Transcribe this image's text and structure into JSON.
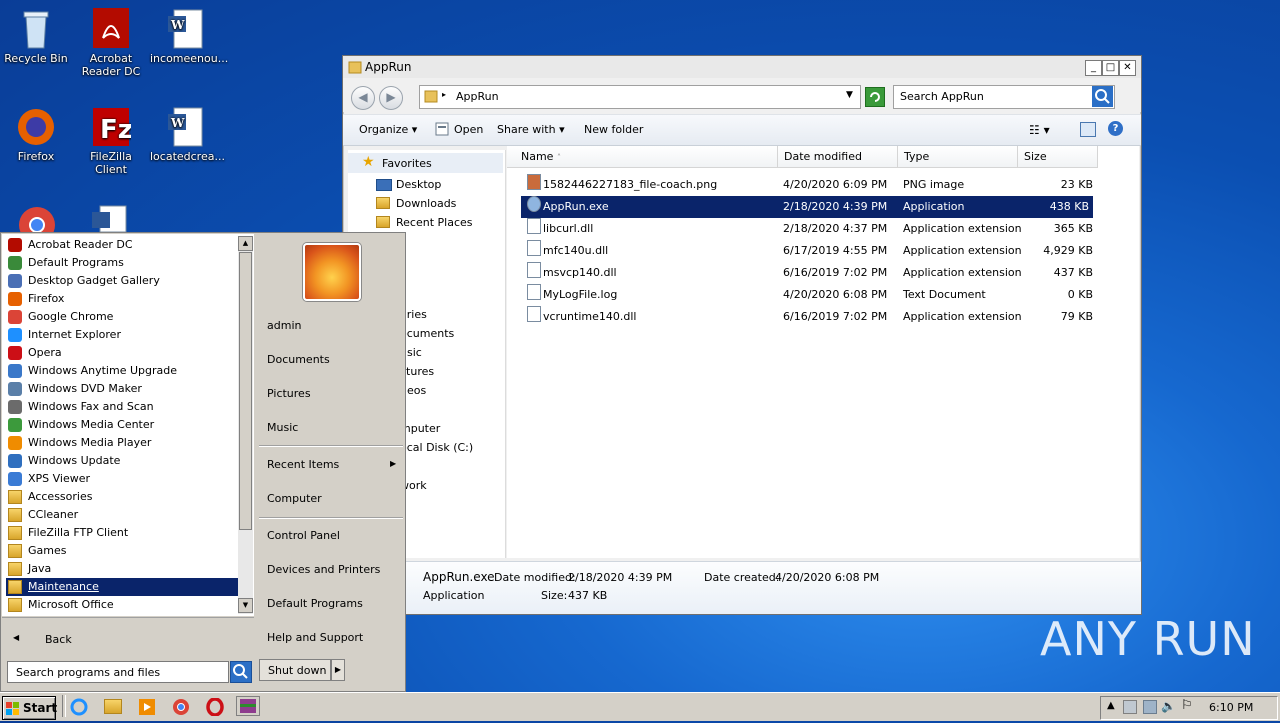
{
  "desktop": {
    "icons": [
      {
        "label": "Recycle Bin"
      },
      {
        "label": "Acrobat\nReader DC"
      },
      {
        "label": "incomeenou..."
      },
      {
        "label": "Firefox"
      },
      {
        "label": "FileZilla Client"
      },
      {
        "label": "locatedcrea..."
      }
    ]
  },
  "explorer": {
    "title": "AppRun",
    "address": "AppRun",
    "search_placeholder": "Search AppRun",
    "toolbar": {
      "organize": "Organize",
      "open": "Open",
      "share_with": "Share with",
      "new_folder": "New folder"
    },
    "nav": {
      "favorites": "Favorites",
      "items": [
        "Desktop",
        "Downloads",
        "Recent Places"
      ],
      "partial": [
        "aries",
        "ocuments",
        "usic",
        "ctures",
        "deos",
        "mputer",
        "ocal Disk (C:)",
        "work"
      ]
    },
    "columns": [
      "Name",
      "Date modified",
      "Type",
      "Size"
    ],
    "files": [
      {
        "name": "1582446227183_file-coach.png",
        "date": "4/20/2020 6:09 PM",
        "type": "PNG image",
        "size": "23 KB",
        "selected": false
      },
      {
        "name": "AppRun.exe",
        "date": "2/18/2020 4:39 PM",
        "type": "Application",
        "size": "438 KB",
        "selected": true
      },
      {
        "name": "libcurl.dll",
        "date": "2/18/2020 4:37 PM",
        "type": "Application extension",
        "size": "365 KB",
        "selected": false
      },
      {
        "name": "mfc140u.dll",
        "date": "6/17/2019 4:55 PM",
        "type": "Application extension",
        "size": "4,929 KB",
        "selected": false
      },
      {
        "name": "msvcp140.dll",
        "date": "6/16/2019 7:02 PM",
        "type": "Application extension",
        "size": "437 KB",
        "selected": false
      },
      {
        "name": "MyLogFile.log",
        "date": "4/20/2020 6:08 PM",
        "type": "Text Document",
        "size": "0 KB",
        "selected": false
      },
      {
        "name": "vcruntime140.dll",
        "date": "6/16/2019 7:02 PM",
        "type": "Application extension",
        "size": "79 KB",
        "selected": false
      }
    ],
    "details": {
      "name": "AppRun.exe",
      "modified_label": "Date modified:",
      "modified": "2/18/2020 4:39 PM",
      "created_label": "Date created:",
      "created": "4/20/2020 6:08 PM",
      "type": "Application",
      "size_label": "Size:",
      "size": "437 KB"
    }
  },
  "startmenu": {
    "programs": [
      {
        "label": "Acrobat Reader DC",
        "color": "#b30b00"
      },
      {
        "label": "Default Programs",
        "color": "#3a8a3a"
      },
      {
        "label": "Desktop Gadget Gallery",
        "color": "#4a6fb5"
      },
      {
        "label": "Firefox",
        "color": "#e66000"
      },
      {
        "label": "Google Chrome",
        "color": "#db4437"
      },
      {
        "label": "Internet Explorer",
        "color": "#1e90ff"
      },
      {
        "label": "Opera",
        "color": "#cc0f16"
      },
      {
        "label": "Windows Anytime Upgrade",
        "color": "#3a78c9"
      },
      {
        "label": "Windows DVD Maker",
        "color": "#5a7fa8"
      },
      {
        "label": "Windows Fax and Scan",
        "color": "#6b6b6b"
      },
      {
        "label": "Windows Media Center",
        "color": "#3c9a3c"
      },
      {
        "label": "Windows Media Player",
        "color": "#f08c00"
      },
      {
        "label": "Windows Update",
        "color": "#2f6fbf"
      },
      {
        "label": "XPS Viewer",
        "color": "#3a7bd5"
      },
      {
        "label": "Accessories",
        "folder": true
      },
      {
        "label": "CCleaner",
        "folder": true
      },
      {
        "label": "FileZilla FTP Client",
        "folder": true
      },
      {
        "label": "Games",
        "folder": true
      },
      {
        "label": "Java",
        "folder": true
      },
      {
        "label": "Maintenance",
        "folder": true,
        "selected": true
      },
      {
        "label": "Microsoft Office",
        "folder": true
      }
    ],
    "back": "Back",
    "search_placeholder": "Search programs and files",
    "right": [
      "admin",
      "Documents",
      "Pictures",
      "Music",
      "Recent Items",
      "Computer",
      "Control Panel",
      "Devices and Printers",
      "Default Programs",
      "Help and Support"
    ],
    "shutdown": "Shut down"
  },
  "taskbar": {
    "start": "Start",
    "clock": "6:10 PM"
  },
  "watermark": "ANY RUN"
}
